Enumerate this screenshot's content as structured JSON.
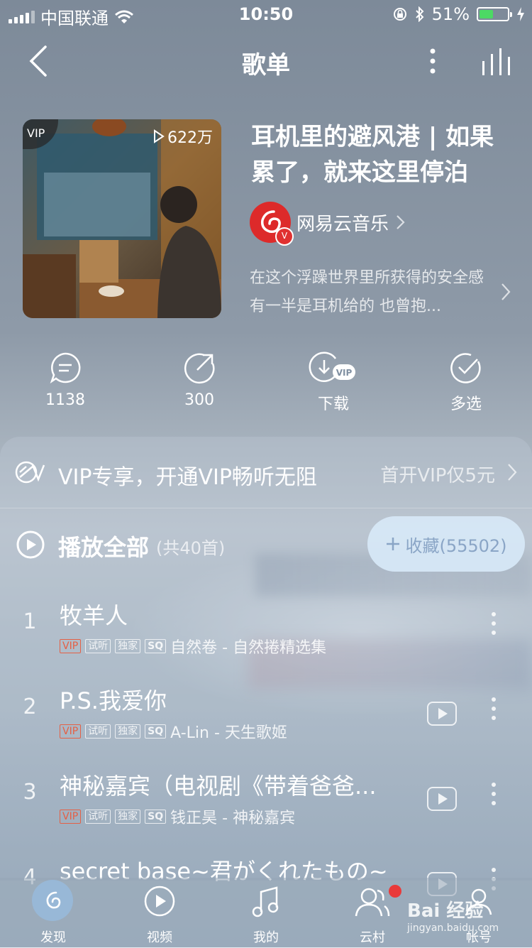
{
  "status_bar": {
    "carrier": "中国联通",
    "time": "10:50",
    "battery": "51%",
    "battery_level": 0.51
  },
  "nav": {
    "title": "歌单"
  },
  "playlist": {
    "cover_badge": "VIP",
    "play_count": "622万",
    "title": "耳机里的避风港 | 如果累了，就来这里停泊",
    "creator": "网易云音乐",
    "description": "在这个浮躁世界里所获得的安全感 有一半是耳机给的 也曾抱..."
  },
  "actions": {
    "comments": "1138",
    "shares": "300",
    "download": "下载",
    "multiselect": "多选"
  },
  "vip_banner": {
    "text": "VIP专享，开通VIP畅听无阻",
    "promo": "首开VIP仅5元"
  },
  "play_all": {
    "label": "播放全部",
    "count": "(共40首)"
  },
  "collect": {
    "label": "收藏(55502)"
  },
  "songs": [
    {
      "index": "1",
      "title": "牧羊人",
      "tags": [
        "VIP",
        "试听",
        "独家",
        "SQ"
      ],
      "subtitle": "自然卷 - 自然捲精选集",
      "has_mv": false
    },
    {
      "index": "2",
      "title": "P.S.我爱你",
      "tags": [
        "VIP",
        "试听",
        "独家",
        "SQ"
      ],
      "subtitle": "A-Lin - 天生歌姬",
      "has_mv": true
    },
    {
      "index": "3",
      "title": "神秘嘉宾（电视剧《带着爸爸...",
      "tags": [
        "VIP",
        "试听",
        "独家",
        "SQ"
      ],
      "subtitle": "钱正昊 - 神秘嘉宾",
      "has_mv": true
    },
    {
      "index": "4",
      "title": "secret base~君がくれたもの~",
      "tags": [],
      "subtitle": "",
      "has_mv": true
    }
  ],
  "tabbar": {
    "items": [
      {
        "label": "发现",
        "icon": "netease-logo-icon",
        "active": true
      },
      {
        "label": "视频",
        "icon": "video-icon",
        "active": false
      },
      {
        "label": "我的",
        "icon": "music-note-icon",
        "active": false
      },
      {
        "label": "云村",
        "icon": "friends-icon",
        "active": false
      },
      {
        "label": "帐号",
        "icon": "account-icon",
        "active": false
      }
    ]
  },
  "watermark": {
    "brand": "Bai 经验",
    "url": "jingyan.baidu.com"
  },
  "colors": {
    "vip_tag": "#e46045",
    "collect_bg": "#d7e8f7",
    "brand_red": "#dd2a2a",
    "battery_green": "#4cd964"
  }
}
